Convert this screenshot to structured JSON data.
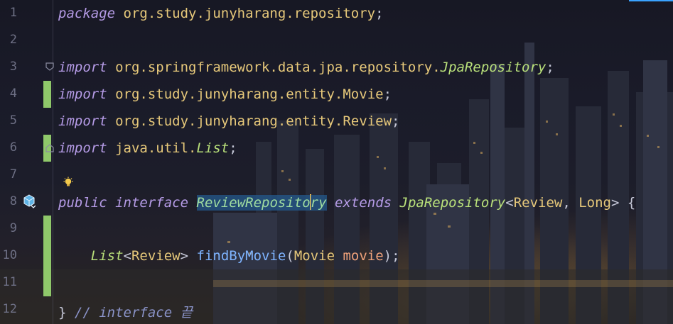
{
  "editor": {
    "lines": [
      {
        "num": "1",
        "segments": [
          {
            "cls": "kw",
            "text": "package"
          },
          {
            "cls": "pkg",
            "text": " org.study.junyharang.repository"
          },
          {
            "cls": "punct",
            "text": ";"
          }
        ]
      },
      {
        "num": "2",
        "segments": []
      },
      {
        "num": "3",
        "segments": [
          {
            "cls": "kw",
            "text": "import"
          },
          {
            "cls": "pkg",
            "text": " org.springframework.data.jpa.repository."
          },
          {
            "cls": "type",
            "text": "JpaRepository"
          },
          {
            "cls": "punct",
            "text": ";"
          }
        ]
      },
      {
        "num": "4",
        "segments": [
          {
            "cls": "kw",
            "text": "import"
          },
          {
            "cls": "pkg",
            "text": " org.study.junyharang.entity.Movie"
          },
          {
            "cls": "punct",
            "text": ";"
          }
        ]
      },
      {
        "num": "5",
        "segments": [
          {
            "cls": "kw",
            "text": "import"
          },
          {
            "cls": "pkg",
            "text": " org.study.junyharang.entity.Review"
          },
          {
            "cls": "punct",
            "text": ";"
          }
        ]
      },
      {
        "num": "6",
        "segments": [
          {
            "cls": "kw",
            "text": "import"
          },
          {
            "cls": "pkg",
            "text": " java.util."
          },
          {
            "cls": "type",
            "text": "List"
          },
          {
            "cls": "punct",
            "text": ";"
          }
        ]
      },
      {
        "num": "7",
        "segments": []
      },
      {
        "num": "8",
        "segments": [
          {
            "cls": "kw",
            "text": "public"
          },
          {
            "cls": "punct",
            "text": " "
          },
          {
            "cls": "kw",
            "text": "interface"
          },
          {
            "cls": "punct",
            "text": " "
          },
          {
            "cls": "sel",
            "text": "ReviewReposito"
          },
          {
            "cls": "caret",
            "text": ""
          },
          {
            "cls": "sel",
            "text": "ry"
          },
          {
            "cls": "punct",
            "text": " "
          },
          {
            "cls": "kw",
            "text": "extends"
          },
          {
            "cls": "punct",
            "text": " "
          },
          {
            "cls": "type",
            "text": "JpaRepository"
          },
          {
            "cls": "punct",
            "text": "<"
          },
          {
            "cls": "cls",
            "text": "Review"
          },
          {
            "cls": "punct",
            "text": ", "
          },
          {
            "cls": "cls",
            "text": "Long"
          },
          {
            "cls": "punct",
            "text": "> {"
          }
        ]
      },
      {
        "num": "9",
        "segments": []
      },
      {
        "num": "10",
        "segments": [
          {
            "cls": "punct",
            "text": "    "
          },
          {
            "cls": "type",
            "text": "List"
          },
          {
            "cls": "punct",
            "text": "<"
          },
          {
            "cls": "cls",
            "text": "Review"
          },
          {
            "cls": "punct",
            "text": "> "
          },
          {
            "cls": "fn",
            "text": "findByMovie"
          },
          {
            "cls": "punct",
            "text": "("
          },
          {
            "cls": "cls",
            "text": "Movie"
          },
          {
            "cls": "punct",
            "text": " "
          },
          {
            "cls": "param",
            "text": "movie"
          },
          {
            "cls": "punct",
            "text": ");"
          }
        ]
      },
      {
        "num": "11",
        "segments": []
      },
      {
        "num": "12",
        "segments": [
          {
            "cls": "punct",
            "text": "} "
          },
          {
            "cls": "cmt",
            "text": "// interface 끝"
          }
        ]
      }
    ]
  },
  "icons": {
    "fold_marker": "fold-icon",
    "intention_bulb": "lightbulb-icon",
    "implemented_gutter": "implemented-interface-icon"
  },
  "colors": {
    "keyword": "#b59be6",
    "package": "#e6c87a",
    "type": "#b9e07a",
    "function": "#7fb4ff",
    "parameter": "#f0a27a",
    "comment": "#8a93c8",
    "change_bar": "#8fc86a",
    "selection": "#245a8c",
    "caret": "#ffcc55"
  }
}
